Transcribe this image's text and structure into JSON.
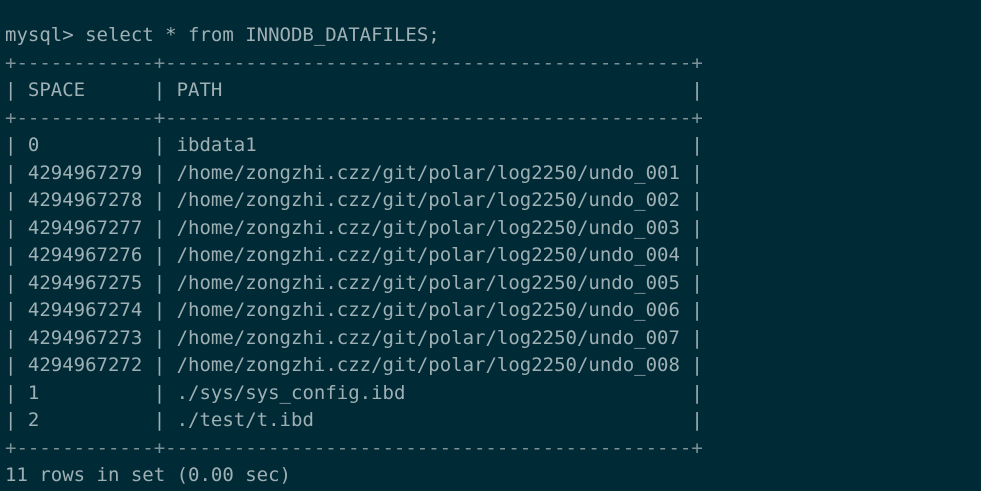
{
  "terminal": {
    "prompt": "mysql>",
    "command": "select * from INNODB_DATAFILES;",
    "table": {
      "border": "+------------+----------------------------------------------+",
      "headers": [
        "SPACE",
        "PATH"
      ],
      "rows": [
        [
          "0",
          "ibdata1"
        ],
        [
          "4294967279",
          "/home/zongzhi.czz/git/polar/log2250/undo_001"
        ],
        [
          "4294967278",
          "/home/zongzhi.czz/git/polar/log2250/undo_002"
        ],
        [
          "4294967277",
          "/home/zongzhi.czz/git/polar/log2250/undo_003"
        ],
        [
          "4294967276",
          "/home/zongzhi.czz/git/polar/log2250/undo_004"
        ],
        [
          "4294967275",
          "/home/zongzhi.czz/git/polar/log2250/undo_005"
        ],
        [
          "4294967274",
          "/home/zongzhi.czz/git/polar/log2250/undo_006"
        ],
        [
          "4294967273",
          "/home/zongzhi.czz/git/polar/log2250/undo_007"
        ],
        [
          "4294967272",
          "/home/zongzhi.czz/git/polar/log2250/undo_008"
        ],
        [
          "1",
          "./sys/sys_config.ibd"
        ],
        [
          "2",
          "./test/t.ibd"
        ]
      ]
    },
    "result": "11 rows in set (0.00 sec)",
    "colors": {
      "background": "#002b36",
      "text": "#9fb0b5"
    }
  }
}
